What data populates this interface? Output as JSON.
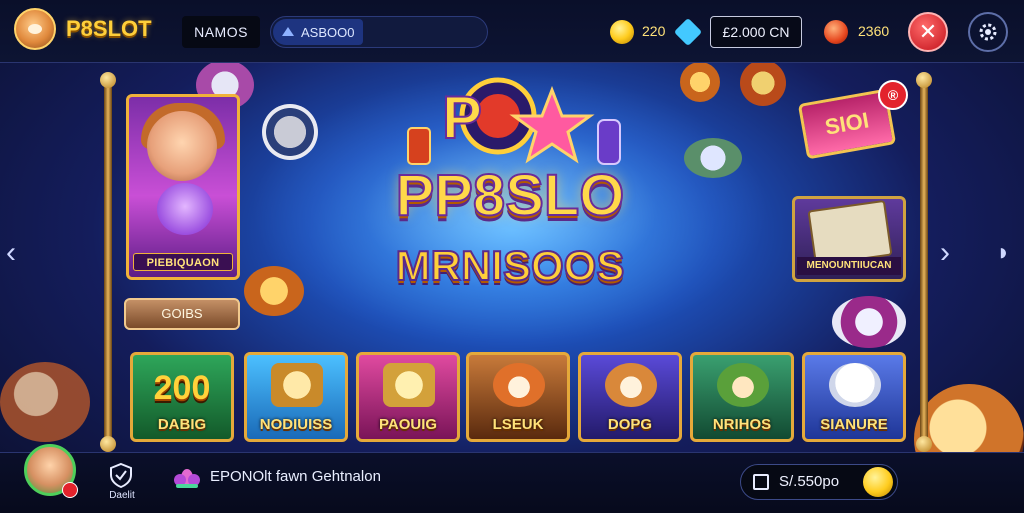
{
  "header": {
    "brand": "P8SLOT",
    "username": "NAMOS",
    "search_value": "ASBOO0",
    "coins": "220",
    "cash": "£2.000 CN",
    "rubies": "2360"
  },
  "hero": {
    "title": "PP8SLO",
    "subtitle": "MRNISOOS"
  },
  "feature": {
    "card_label": "PIEBIQUAON",
    "ribbon_label": "GOIBS"
  },
  "promo": {
    "banner_text": "SIOI",
    "badge_text": "®",
    "card_label": "MENOUNTIIUCAN"
  },
  "games": [
    {
      "big": "200",
      "label": "DABIG",
      "bg": "#1f7a3a"
    },
    {
      "big": "",
      "label": "NODIUISS",
      "bg": "#2b9ad8"
    },
    {
      "big": "",
      "label": "PAOUIG",
      "bg": "#b9247a"
    },
    {
      "big": "",
      "label": "LSEUK",
      "bg": "#8a4a1e"
    },
    {
      "big": "",
      "label": "DOPG",
      "bg": "#3b2a8e"
    },
    {
      "big": "",
      "label": "NRIHOS",
      "bg": "#237a5a"
    },
    {
      "big": "",
      "label": "SIANURE",
      "bg": "#3452b6"
    }
  ],
  "footer": {
    "shield_label": "Daelit",
    "ticker": "EPONOlt fawn Gehtnalon",
    "balance": "S/.550po"
  },
  "icons": {
    "search": "search-icon",
    "close": "close-icon",
    "settings": "gear-icon",
    "prev": "chevron-left-icon",
    "next": "chevron-right-icon",
    "wallet": "wallet-icon"
  },
  "colors": {
    "accent_gold": "#ffd94a",
    "danger": "#e3232c",
    "frame_gold": "#e5a93a"
  }
}
